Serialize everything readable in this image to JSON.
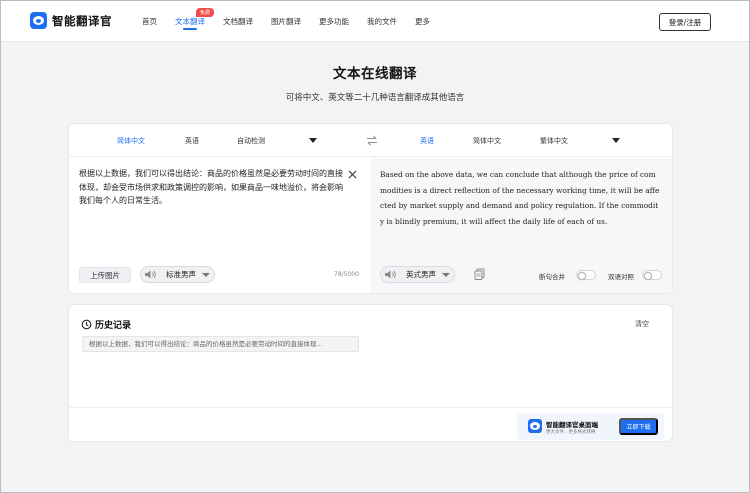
{
  "header": {
    "app_name": "智能翻译官",
    "nav": [
      {
        "label": "首页"
      },
      {
        "label": "文本翻译",
        "badge": "免费"
      },
      {
        "label": "文档翻译"
      },
      {
        "label": "图片翻译"
      },
      {
        "label": "更多功能"
      },
      {
        "label": "我的文件"
      },
      {
        "label": "更多"
      }
    ],
    "login_label": "登录/注册"
  },
  "page": {
    "title": "文本在线翻译",
    "subtitle": "可将中文、英文等二十几种语言翻译成其他语言"
  },
  "translator": {
    "source_langs": [
      "简体中文",
      "英语",
      "自动检测"
    ],
    "target_langs": [
      "英语",
      "简体中文",
      "繁体中文"
    ],
    "source_text": "根据以上数据，我们可以得出结论：商品的价格虽然是必要劳动时间的直接体现，却会受市场供求和政策调控的影响，如果商品一味地溢价，将会影响我们每个人的日常生活。",
    "target_text": "Based on the above data, we can conclude that although the price of commodities is a direct reflection of the necessary working time, it will be affected by market supply and demand and policy regulation. If the commodity is blindly premium, it will affect the daily life of each of us.",
    "upload_label": "上传图片",
    "source_voice": "标准男声",
    "char_count": "78/5000",
    "target_voice": "英式男声",
    "toggle_1": "断句合并",
    "toggle_2": "双语对照"
  },
  "history": {
    "title": "历史记录",
    "clear_label": "清空",
    "items": [
      "根据以上数据，我们可以得出结论：商品的价格虽然是必要劳动时间的直接体现..."
    ]
  },
  "promo": {
    "title": "智能翻译官桌面端",
    "subtitle": "更大文件、更多格式转换",
    "button_label": "立即下载"
  },
  "colors": {
    "accent": "#1e6ef2",
    "badge": "#f24b4b",
    "background": "#f2f3f5"
  }
}
